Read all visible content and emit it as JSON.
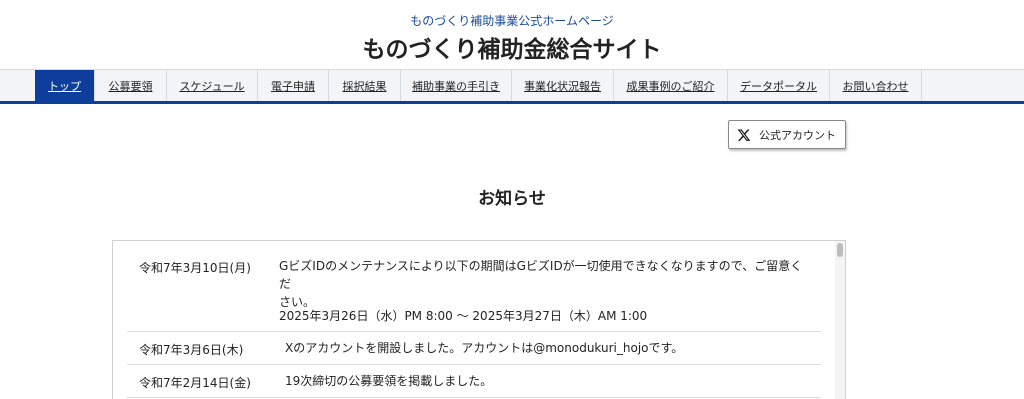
{
  "header": {
    "subtitle": "ものづくり補助事業公式ホームページ",
    "title": "ものづくり補助金総合サイト"
  },
  "nav": {
    "items": [
      {
        "label": "トップ",
        "active": true
      },
      {
        "label": "公募要領"
      },
      {
        "label": "スケジュール"
      },
      {
        "label": "電子申請"
      },
      {
        "label": "採択結果"
      },
      {
        "label": "補助事業の手引き"
      },
      {
        "label": "事業化状況報告"
      },
      {
        "label": "成果事例のご紹介"
      },
      {
        "label": "データポータル"
      },
      {
        "label": "お問い合わせ"
      }
    ]
  },
  "x_account": {
    "icon": "x-logo-icon",
    "label": "公式アカウント"
  },
  "news": {
    "title": "お知らせ",
    "items": [
      {
        "date": "令和7年3月10日(月)",
        "text_line1": "GビズIDのメンテナンスにより以下の期間はGビズIDが一切使用できなくなりますので、ご留意くだ",
        "text_line2": "さい。",
        "text_line3": "2025年3月26日（水）PM 8:00 〜 2025年3月27日（木）AM 1:00"
      },
      {
        "date": "令和7年3月6日(木)",
        "text": "Xのアカウントを開設しました。アカウントは@monodukuri_hojoです。"
      },
      {
        "date": "令和7年2月14日(金)",
        "text": "19次締切の公募要領を掲載しました。"
      }
    ]
  }
}
